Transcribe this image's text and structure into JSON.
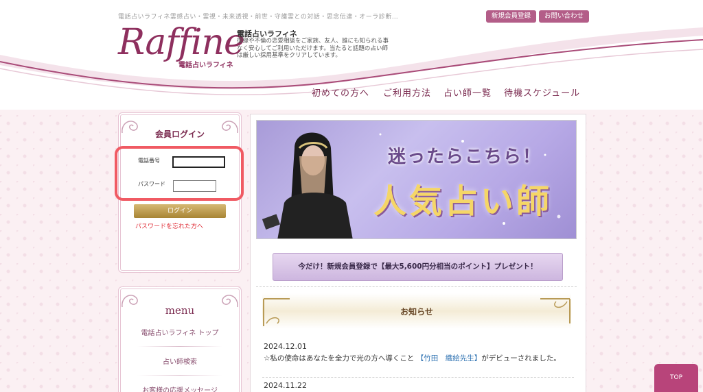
{
  "header": {
    "tagline": "電話占いラフィネ霊感占い・霊視・未来透視・前世・守護霊との対話・思念伝達・オーラ診断…",
    "register_label": "新規会員登録",
    "contact_label": "お問い合わせ",
    "logo_text": "Raffine",
    "logo_sub": "電話占いラフィネ",
    "site_title": "電話占いラフィネ",
    "site_desc": "復縁や不倫の恋愛相談をご家族、友人、誰にも知られる事なく安心してご利用いただけます。当たると話題の占い師は厳しい採用基準をクリアしています。"
  },
  "nav": {
    "items": [
      "初めての方へ",
      "ご利用方法",
      "占い師一覧",
      "待機スケジュール"
    ]
  },
  "login": {
    "title": "会員ログイン",
    "phone_label": "電話番号",
    "password_label": "パスワード",
    "phone_value": "",
    "password_value": "",
    "button_label": "ログイン",
    "forgot_label": "パスワードを忘れた方へ"
  },
  "menu": {
    "title": "menu",
    "items": [
      "電話占いラフィネ トップ",
      "占い師検索",
      "お客様の応援メッセージ"
    ]
  },
  "banner": {
    "subtitle": "迷ったらこちら！",
    "title": "人気占い師"
  },
  "promo": {
    "label": "今だけ！新規会員登録で【最大5,600円分相当のポイント】プレゼント！"
  },
  "news": {
    "title": "お知らせ",
    "items": [
      {
        "date": "2024.12.01",
        "text_before": "☆私の使命はあなたを全力で光の方へ導くこと ",
        "link": "【竹田　織絵先生】",
        "text_after": "がデビューされました。"
      },
      {
        "date": "2024.11.22"
      }
    ]
  },
  "top_button": "TOP",
  "colors": {
    "accent": "#b35d88",
    "nav": "#7a2a4f",
    "highlight": "#f05a63",
    "gold": "#c2a24f"
  }
}
